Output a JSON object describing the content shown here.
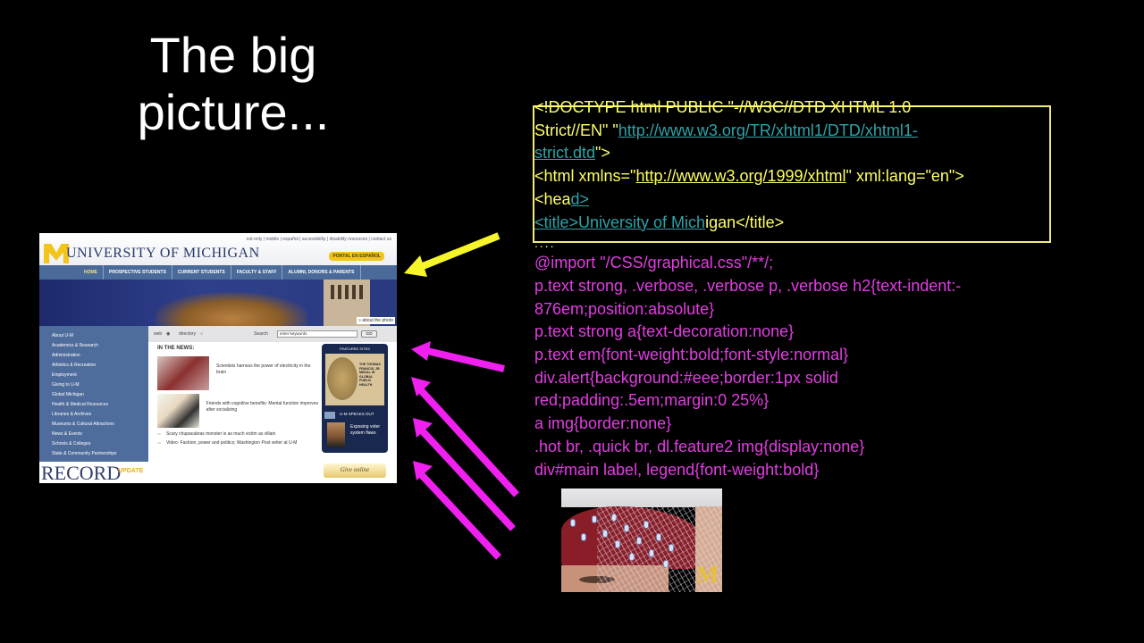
{
  "slide": {
    "title_line1": "The big",
    "title_line2": "picture..."
  },
  "code": {
    "highlighted": {
      "doctype_line1": "<!DOCTYPE html PUBLIC \"-//W3C//DTD XHTML 1.0",
      "doctype_line2_prefix": "Strict//EN\" \"",
      "doctype_link_part1": "http://www.w3.org/TR/xhtml1/DTD/xhtml1-",
      "doctype_link_part2": "strict.dtd",
      "doctype_line3_suffix": "\">",
      "html_prefix": "<html xmlns=\"",
      "html_link": "http://www.w3.org/1999/xhtml",
      "html_suffix": "\" xml:lang=\"en\">",
      "head_prefix": "<hea",
      "head_link": "d>",
      "title_link": "<title>University of Mich",
      "title_suffix": "igan</title>"
    },
    "ellipsis": "....",
    "css_lines": [
      "@import \"/CSS/graphical.css\"/**/;",
      "p.text strong, .verbose, .verbose p, .verbose h2{text-indent:-",
      "876em;position:absolute}",
      "p.text strong a{text-decoration:none}",
      "p.text em{font-weight:bold;font-style:normal}",
      "div.alert{background:#eee;border:1px solid",
      "red;padding:.5em;margin:0 25%}",
      "a img{border:none}",
      ".hot br, .quick br, dl.feature2 img{display:none}",
      "div#main label, legend{font-weight:bold}"
    ]
  },
  "colors": {
    "html_text": "#ffff66",
    "link_text": "#2fa2a8",
    "css_text": "#e43ce4",
    "arrow_yellow": "#f5f52a",
    "arrow_magenta": "#f020f0",
    "box_border": "#f2ec78"
  },
  "website": {
    "utility_links": "ext-only | mobile | español | accessibility | disability resources | contact us",
    "logo_text": "UNIVERSITY OF MICHIGAN",
    "espanol_button": "PORTAL EN ESPAÑOL",
    "nav": [
      "HOME",
      "PROSPECTIVE STUDENTS",
      "CURRENT STUDENTS",
      "FACULTY & STAFF",
      "ALUMNI, DONORS & PARENTS"
    ],
    "about_photo": "» about the photo",
    "sidebar": [
      "About U-M",
      "Academics & Research",
      "Administration",
      "Athletics & Recreation",
      "Employment",
      "Giving to U-M",
      "Global Michigan",
      "Health & Medical Resources",
      "Libraries & Archives",
      "Museums & Cultural Attractions",
      "News & Events",
      "Schools & Colleges",
      "State & Community Partnerships"
    ],
    "record_logo": "RECORD",
    "record_update": "UPDATE",
    "search": {
      "web_label": "web",
      "directory_label": "directory",
      "search_label": "Search",
      "placeholder": "enter keywords",
      "go_label": "GO"
    },
    "news": {
      "heading": "IN THE NEWS:",
      "items": [
        "Scientists harness the power of electricity in the brain",
        "Friends with cognitive benefits: Mental function improves after socializing"
      ],
      "bullets": [
        "Scary chupacabras monster is as much victim as villain",
        "Video: Fashion, power and politics; Washington Post writer at U-M"
      ]
    },
    "featured": {
      "heading": "FEATURED SITES",
      "medal_text": "THE THOMAS FRANCIS, JR. MEDAL IN GLOBAL PUBLIC HEALTH",
      "speaks_out": "U-M SPEAKS OUT",
      "speaks_text": "Exposing voter system flaws"
    },
    "give_online": "Give online"
  },
  "eeg_image": {
    "logo": "M"
  }
}
